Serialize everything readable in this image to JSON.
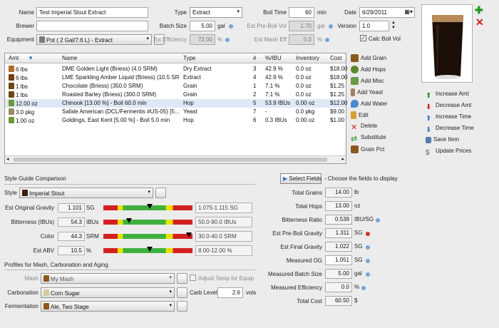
{
  "recipe": {
    "name_label": "Name",
    "name_value": "Test Imperial Stout Extract",
    "brewer_label": "Brewer",
    "brewer_value": "",
    "equipment_label": "Equipment",
    "equipment_value": "Pot ( 2 Gal/7.6 L) - Extract",
    "type_label": "Type",
    "type_value": "Extract",
    "batch_label": "Batch Size",
    "batch_value": "5.00",
    "batch_unit": "gal",
    "efficiency_label": "Tot Efficiency",
    "efficiency_value": "72.00",
    "efficiency_unit": "%",
    "boiltime_label": "Boil Time",
    "boiltime_value": "60",
    "boiltime_unit": "min",
    "preboil_label": "Est Pre-Boil Vol",
    "preboil_value": "1.70",
    "preboil_unit": "gal",
    "masheff_label": "Est Mash Eff",
    "masheff_value": "0.0",
    "masheff_unit": "%",
    "date_label": "Date",
    "date_value": "6/29/2011",
    "version_label": "Version",
    "version_value": "1.0",
    "calc_boil_label": "Calc Boil Vol"
  },
  "grid": {
    "headers": [
      "Amt",
      "Name",
      "Type",
      "#",
      "%/IBU",
      "Inventory",
      "Cost"
    ],
    "rows": [
      {
        "amt": "6 lbs",
        "name": "DME Golden Light (Briess) (4.0 SRM)",
        "type": "Dry Extract",
        "num": "3",
        "pct": "42.9 %",
        "inv": "0.0 oz",
        "cost": "$18.00",
        "icon": "#b46a2a"
      },
      {
        "amt": "6 lbs",
        "name": "LME Sparkling Amber Liquid (Briess) (10.5 SR...",
        "type": "Extract",
        "num": "4",
        "pct": "42.9 %",
        "inv": "0.0 oz",
        "cost": "$18.00",
        "icon": "#7a3b12"
      },
      {
        "amt": "1 lbs",
        "name": "Chocolate (Briess) (350.0 SRM)",
        "type": "Grain",
        "num": "1",
        "pct": "7.1 %",
        "inv": "0.0 oz",
        "cost": "$1.25",
        "icon": "#6b4a10"
      },
      {
        "amt": "1 lbs",
        "name": "Roasted Barley (Briess) (300.0 SRM)",
        "type": "Grain",
        "num": "2",
        "pct": "7.1 %",
        "inv": "0.0 oz",
        "cost": "$1.25",
        "icon": "#6b4a10"
      },
      {
        "amt": "12.00 oz",
        "name": "Chinook [13.00 %] - Boil 60.0 min",
        "type": "Hop",
        "num": "5",
        "pct": "53.9 IBUs",
        "inv": "0.00 oz",
        "cost": "$12.00",
        "icon": "#6a9a3a"
      },
      {
        "amt": "3.0 pkg",
        "name": "Safale American  (DCL/Fermentis #US-05) [5...",
        "type": "Yeast",
        "num": "7",
        "pct": "-",
        "inv": "0.0 pkg",
        "cost": "$9.00",
        "icon": "#9a8a6a"
      },
      {
        "amt": "1.00 oz",
        "name": "Goldings, East Kent [5.00 %] - Boil 5.0 min",
        "type": "Hop",
        "num": "6",
        "pct": "0.3 IBUs",
        "inv": "0.00 oz",
        "cost": "$1.00",
        "icon": "#6a9a3a"
      }
    ]
  },
  "actions": {
    "add_grain": "Add Grain",
    "add_hops": "Add Hops",
    "add_misc": "Add Misc",
    "add_yeast": "Add Yeast",
    "add_water": "Add Water",
    "edit": "Edit",
    "delete": "Delete",
    "substitute": "Substitute",
    "grain_pct": "Grain Pct"
  },
  "side": {
    "increase_amt": "Increase Amt",
    "decrease_amt": "Decrease Amt",
    "increase_time": "Increase Time",
    "decrease_time": "Decrease Time",
    "save_item": "Save Item",
    "update_prices": "Update Prices"
  },
  "style": {
    "section_title": "Style Guide Comparison",
    "style_label": "Style",
    "style_value": "Imperial Stout",
    "metrics": [
      {
        "label": "Est Original Gravity",
        "value": "1.101",
        "unit": "SG",
        "range": "1.075-1.115 SG",
        "marker": 0.52
      },
      {
        "label": "Bitterness (IBUs)",
        "value": "54.3",
        "unit": "IBUs",
        "range": "50.0-90.0 IBUs",
        "marker": 0.29
      },
      {
        "label": "Color",
        "value": "44.3",
        "unit": "SRM",
        "range": "30.0-40.0 SRM",
        "marker": 0.96
      },
      {
        "label": "Est ABV",
        "value": "10.5",
        "unit": "%",
        "range": "8.00-12.00 %",
        "marker": 0.52
      }
    ]
  },
  "profiles": {
    "section_title": "Profiles for Mash, Carbonation and Aging",
    "mash_label": "Mash",
    "mash_value": "My Mash",
    "adjust_label": "Adjust Temp for Equip",
    "carb_label": "Carbonation",
    "carb_value": "Corn Sugar",
    "carblevel_label": "Carb Level",
    "carblevel_value": "2.6",
    "carblevel_unit": "vols",
    "ferm_label": "Fermentation",
    "ferm_value": "Ale, Two Stage"
  },
  "fields": {
    "select_button": "Select Fields",
    "hint": "- Choose the fields to display",
    "items": [
      {
        "label": "Total Grains",
        "value": "14.00",
        "unit": "lb"
      },
      {
        "label": "Total Hops",
        "value": "13.00",
        "unit": "oz"
      },
      {
        "label": "Bitterness Ratio",
        "value": "0.539",
        "unit": "IBU/SG"
      },
      {
        "label": "Est Pre-Boil Gravity",
        "value": "1.311",
        "unit": "SG"
      },
      {
        "label": "Est Final Gravity",
        "value": "1.022",
        "unit": "SG"
      },
      {
        "label": "Measured OG",
        "value": "1.051",
        "unit": "SG"
      },
      {
        "label": "Measured Batch Size",
        "value": "5.00",
        "unit": "gal"
      },
      {
        "label": "Measured Efficiency",
        "value": "0.0",
        "unit": "%"
      },
      {
        "label": "Total Cost",
        "value": "60.50",
        "unit": "$"
      }
    ]
  }
}
